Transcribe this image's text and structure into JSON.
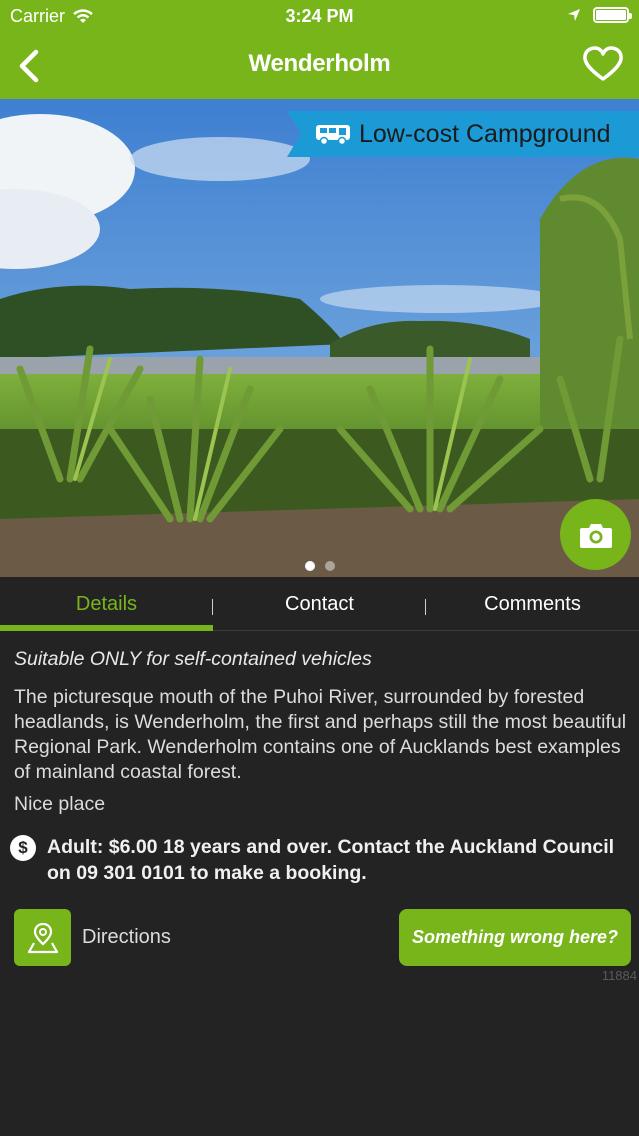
{
  "status_bar": {
    "carrier": "Carrier",
    "time": "3:24 PM",
    "icons": [
      "wifi-icon",
      "location-arrow-icon",
      "battery-icon"
    ]
  },
  "nav": {
    "title": "Wenderholm",
    "back_icon": "chevron-left-icon",
    "favorite_icon": "heart-outline-icon"
  },
  "hero": {
    "badge_label": "Low-cost Campground",
    "badge_icon": "campervan-icon",
    "camera_icon": "camera-icon",
    "page_dots": 2,
    "active_dot": 1
  },
  "tabs": [
    {
      "label": "Details",
      "active": true
    },
    {
      "label": "Contact",
      "active": false
    },
    {
      "label": "Comments",
      "active": false
    }
  ],
  "details": {
    "notice": "Suitable ONLY for self-contained vehicles",
    "description": "The picturesque mouth of the Puhoi River, surrounded by forested headlands, is Wenderholm, the first and perhaps still the most beautiful Regional Park.  Wenderholm contains one of Aucklands best examples of mainland coastal forest.",
    "note": "Nice place",
    "price_icon_text": "$",
    "price": "Adult:  $6.00  18 years and over. Contact the Auckland Council on 09 301 0101 to make a booking."
  },
  "actions": {
    "directions_label": "Directions",
    "directions_icon": "map-pin-icon",
    "report_label": "Something wrong here?",
    "site_id": "11884"
  },
  "colors": {
    "accent": "#78b51b",
    "badge": "#1c9ad6",
    "background": "#232323"
  }
}
